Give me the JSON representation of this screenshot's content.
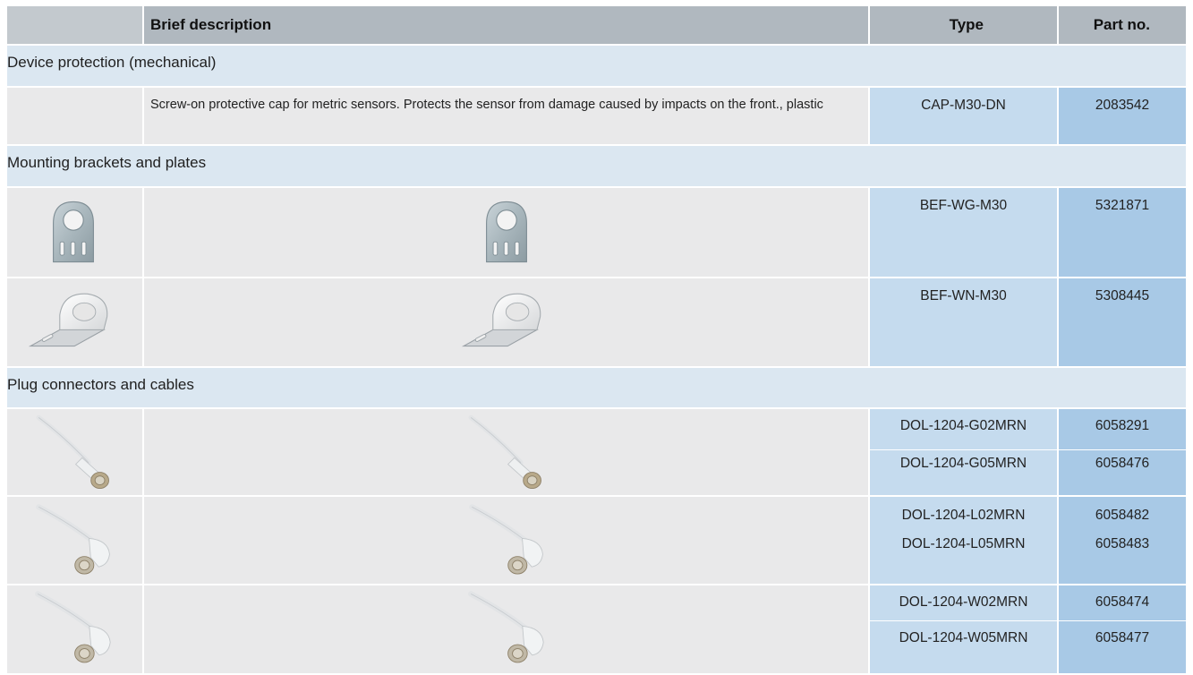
{
  "header": {
    "brief_description": "Brief description",
    "type": "Type",
    "part_no": "Part no."
  },
  "sections": {
    "device_protection": "Device protection (mechanical)",
    "mounting": "Mounting brackets and plates",
    "plug": "Plug connectors and cables"
  },
  "rows": {
    "cap": {
      "description": "Screw-on protective cap for metric sensors. Protects the sensor from damage caused by impacts on the front., plastic",
      "type": "CAP-M30-DN",
      "part_no": "2083542"
    },
    "bef_wg": {
      "type": "BEF-WG-M30",
      "part_no": "5321871",
      "image_icon": "mounting-bracket-icon"
    },
    "bef_wn": {
      "type": "BEF-WN-M30",
      "part_no": "5308445",
      "image_icon": "angle-bracket-icon"
    },
    "dol_g": {
      "image_icon": "straight-cable-connector-icon",
      "items": [
        {
          "type": "DOL-1204-G02MRN",
          "part_no": "6058291"
        },
        {
          "type": "DOL-1204-G05MRN",
          "part_no": "6058476"
        }
      ]
    },
    "dol_l": {
      "image_icon": "angled-cable-connector-icon",
      "items": [
        {
          "type": "DOL-1204-L02MRN",
          "part_no": "6058482"
        },
        {
          "type": "DOL-1204-L05MRN",
          "part_no": "6058483"
        }
      ]
    },
    "dol_w": {
      "image_icon": "angled-cable-connector-icon",
      "items": [
        {
          "type": "DOL-1204-W02MRN",
          "part_no": "6058474"
        },
        {
          "type": "DOL-1204-W05MRN",
          "part_no": "6058477"
        }
      ]
    }
  }
}
